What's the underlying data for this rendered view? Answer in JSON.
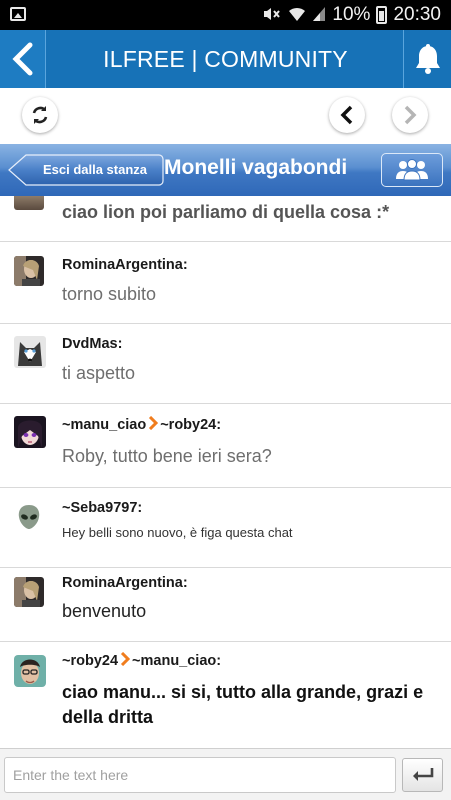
{
  "status_bar": {
    "battery": "10%",
    "time": "20:30"
  },
  "header": {
    "title": "ILFREE | COMMUNITY"
  },
  "room": {
    "exit_label": "Esci dalla stanza",
    "name": "Monelli vagabondi"
  },
  "messages": [
    {
      "author": "",
      "text": "ciao lion poi parliamo di quella cosa :*",
      "avatar": "woman-photo"
    },
    {
      "author": "RominaArgentina:",
      "text": "torno subito",
      "avatar": "woman-photo"
    },
    {
      "author": "DvdMas:",
      "text": "ti aspetto",
      "avatar": "husky-dog"
    },
    {
      "author_from": "~manu_ciao",
      "author_to": "~roby24:",
      "text": "Roby, tutto bene ieri sera?",
      "avatar": "anime-girl"
    },
    {
      "author": "~Seba9797:",
      "text": "Hey belli sono nuovo, è figa questa chat",
      "avatar": "alien-head"
    },
    {
      "author": "RominaArgentina:",
      "text": "benvenuto",
      "avatar": "woman-photo"
    },
    {
      "author_from": "~roby24",
      "author_to": "~manu_ciao:",
      "text": "ciao manu... si si, tutto alla grande, grazi e della dritta",
      "avatar": "man-photo"
    }
  ],
  "composer": {
    "placeholder": "Enter the text here"
  },
  "colors": {
    "header_blue": "#1772b7",
    "room_bar_blue": "#3f78c3",
    "arrow_orange": "#f07d1e"
  },
  "icons": [
    "gallery-icon",
    "mute-icon",
    "wifi-icon",
    "signal-icon",
    "battery-icon",
    "back-icon",
    "bell-icon",
    "refresh-icon",
    "chevron-left-icon",
    "chevron-right-icon",
    "people-icon",
    "enter-icon"
  ]
}
